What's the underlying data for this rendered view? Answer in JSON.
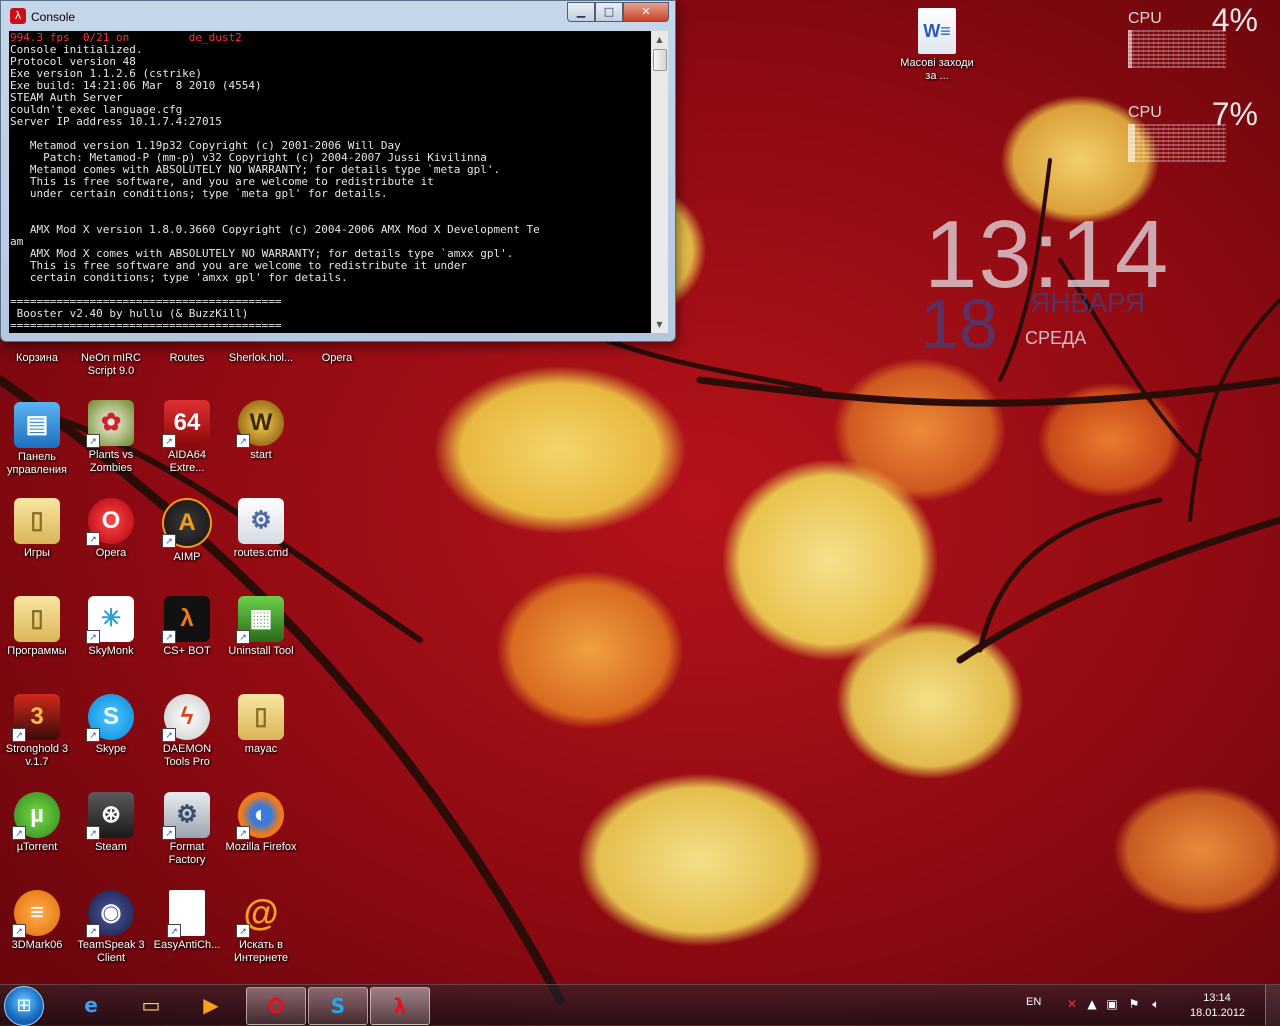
{
  "console": {
    "title": "Console",
    "status_line": "994.3 fps  0/21 on         de_dust2",
    "text": "Console initialized.\nProtocol version 48\nExe version 1.1.2.6 (cstrike)\nExe build: 14:21:06 Mar  8 2010 (4554)\nSTEAM Auth Server\ncouldn't exec language.cfg\nServer IP address 10.1.7.4:27015\n\n   Metamod version 1.19p32 Copyright (c) 2001-2006 Will Day\n     Patch: Metamod-P (mm-p) v32 Copyright (c) 2004-2007 Jussi Kivilinna\n   Metamod comes with ABSOLUTELY NO WARRANTY; for details type `meta gpl'.\n   This is free software, and you are welcome to redistribute it\n   under certain conditions; type `meta gpl' for details.\n\n\n   AMX Mod X version 1.8.0.3660 Copyright (c) 2004-2006 AMX Mod X Development Te\nam\n   AMX Mod X comes with ABSOLUTELY NO WARRANTY; for details type `amxx gpl'.\n   This is free software and you are welcome to redistribute it under\n   certain conditions; type 'amxx gpl' for details.\n\n=========================================\n Booster v2.40 by hullu (& BuzzKill)\n========================================="
  },
  "widgets": {
    "cpu1": {
      "label": "CPU",
      "percent": "4%",
      "load": 0.04
    },
    "cpu2": {
      "label": "CPU",
      "percent": "7%",
      "load": 0.07
    },
    "clock": {
      "time": "13:14",
      "day": "18",
      "month": "января",
      "weekday": "среда"
    }
  },
  "desktop_icons": {
    "korzina": "Корзина",
    "neon": "NeOn mIRC Script 9.0",
    "routes": "Routes",
    "sherlok": "Sherlok.hol...",
    "opera_top": "Opera",
    "panel": "Панель управления",
    "pvz": "Plants vs Zombies",
    "aida": "AIDA64 Extre...",
    "start": "start",
    "igry": "Игры",
    "opera": "Opera",
    "aimp": "AIMP",
    "routes_cmd": "routes.cmd",
    "programmy": "Программы",
    "skymonk": "SkyMonk",
    "csbot": "CS+ BOT",
    "uninstall": "Uninstall Tool",
    "stronghold": "Stronghold 3 v.1.7",
    "skype": "Skype",
    "daemon": "DAEMON Tools Pro",
    "mayac": "mayac",
    "utorrent": "µTorrent",
    "steam": "Steam",
    "format": "Format Factory",
    "firefox": "Mozilla Firefox",
    "3dmark": "3DMark06",
    "teamspeak": "TeamSpeak 3 Client",
    "easyanti": "EasyAntiCh...",
    "iskat": "Искать в Интернете",
    "masovi": "Масові заходи за ..."
  },
  "taskbar": {
    "lang": "EN",
    "time": "13:14",
    "date": "18.01.2012"
  }
}
